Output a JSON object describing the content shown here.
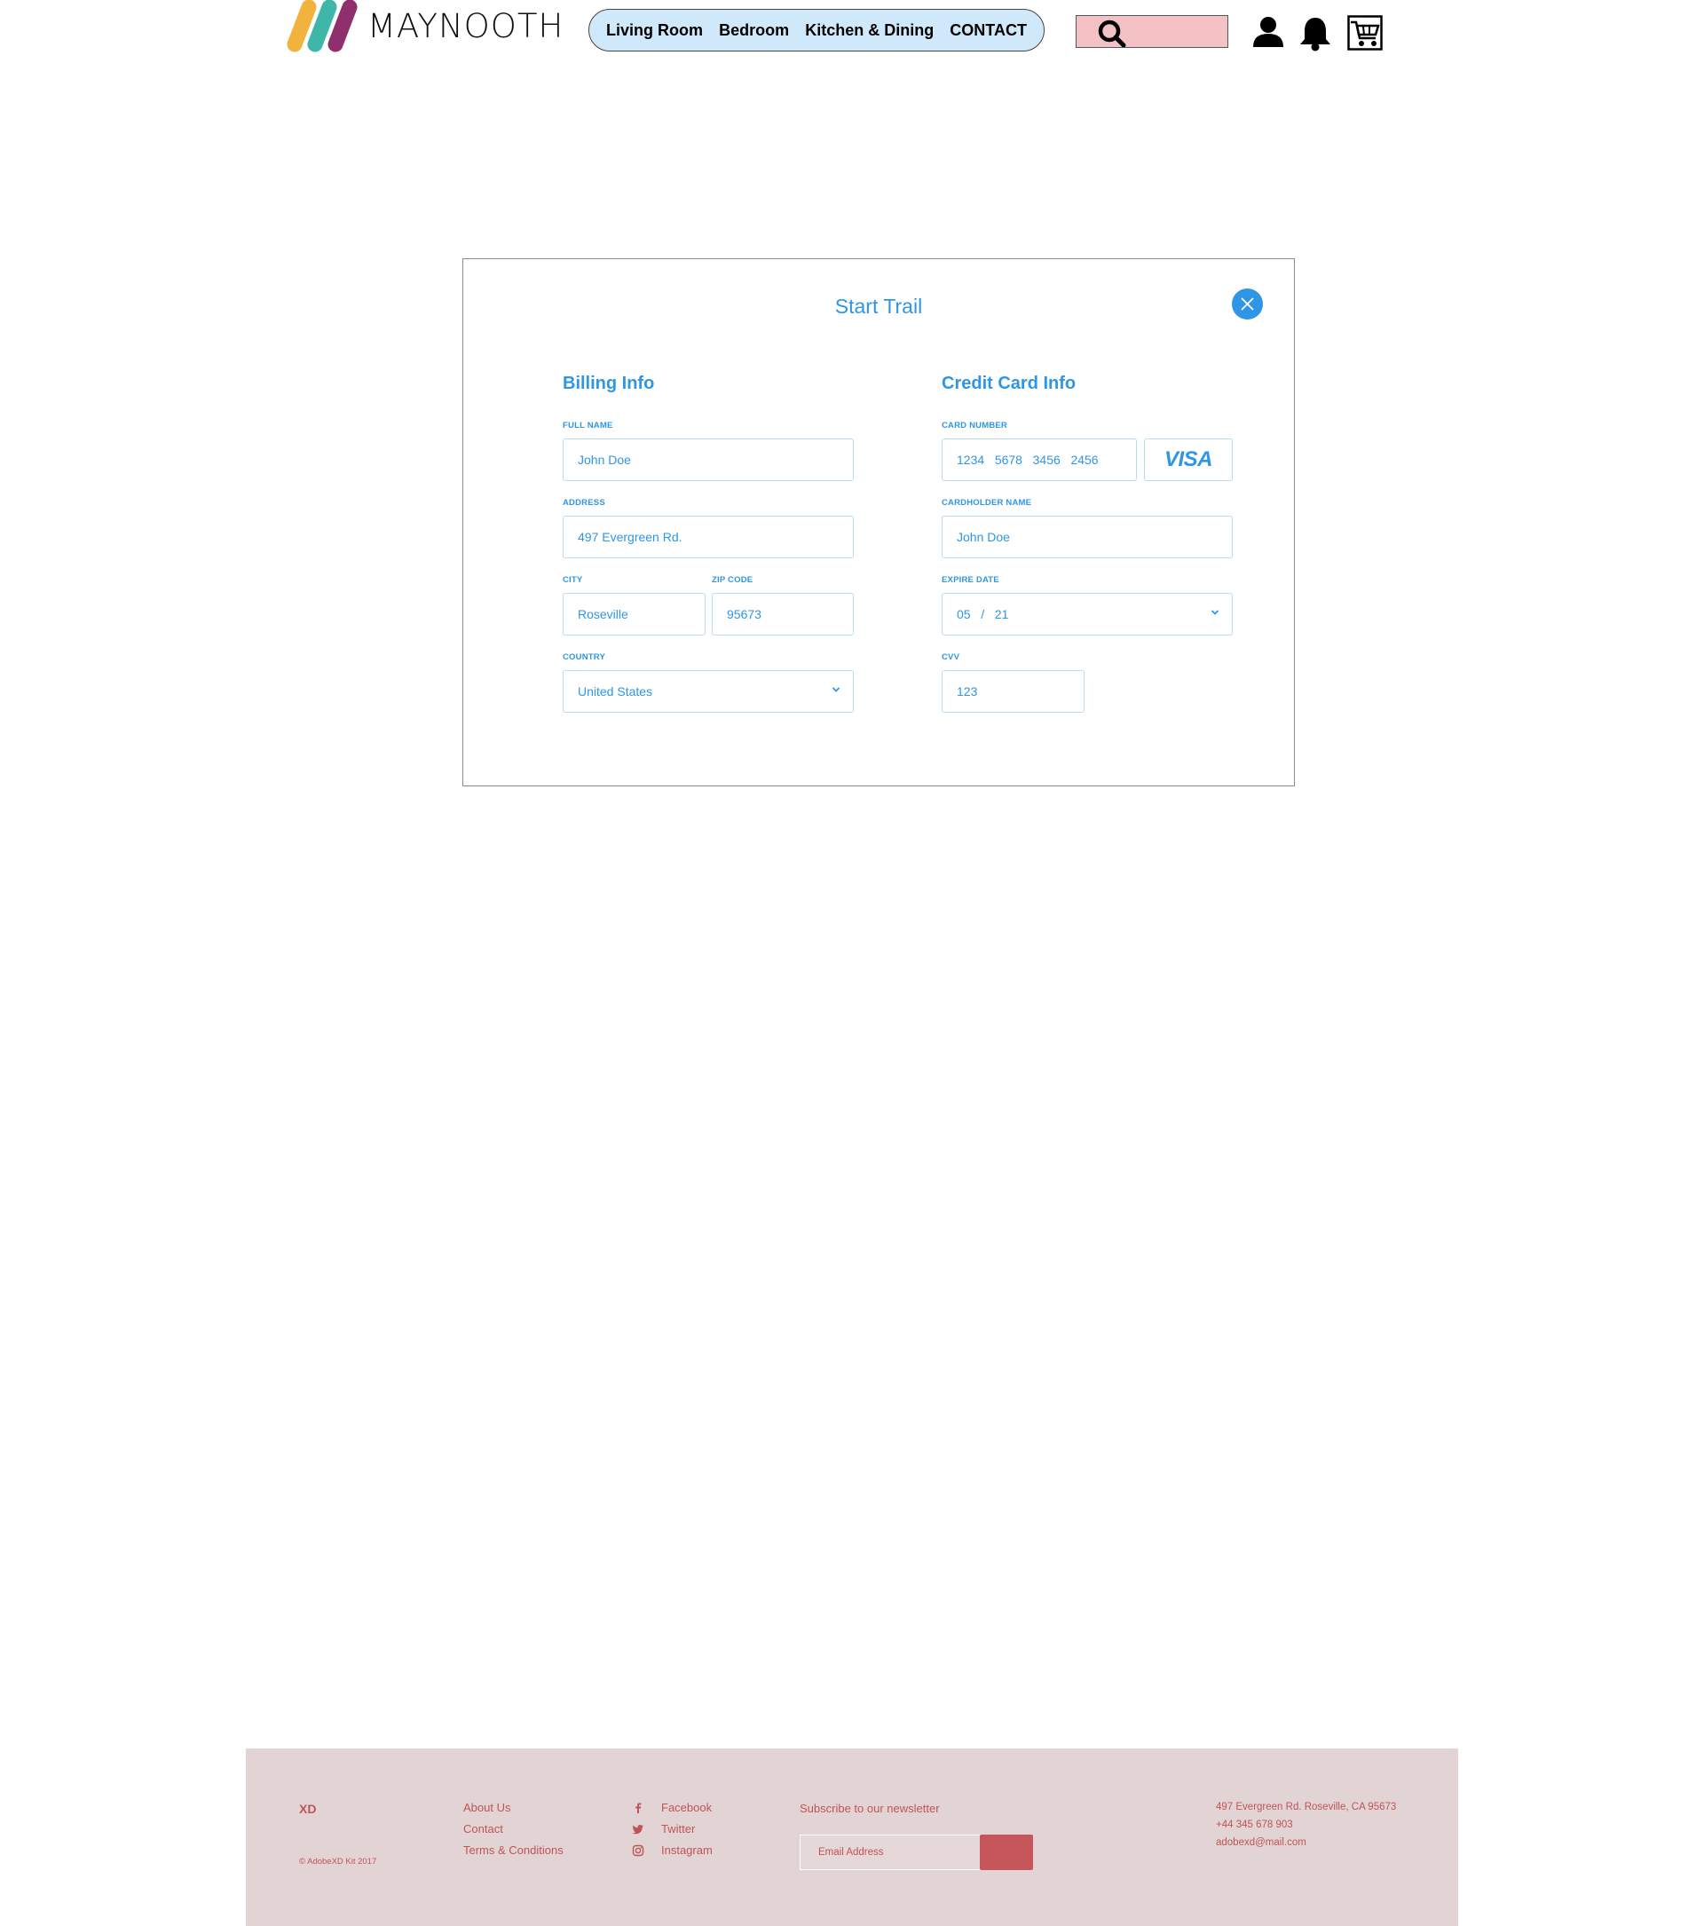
{
  "header": {
    "logo_text": "MAYNOOTH",
    "nav": [
      "Living Room",
      "Bedroom",
      "Kitchen & Dining",
      "CONTACT"
    ],
    "search_value": "",
    "icons": [
      "search-icon",
      "user-icon",
      "bell-icon",
      "cart-icon"
    ]
  },
  "modal": {
    "title": "Start Trail",
    "billing": {
      "heading": "Billing Info",
      "full_name_label": "FULL NAME",
      "full_name": "John Doe",
      "address_label": "ADDRESS",
      "address": "497 Evergreen Rd.",
      "city_label": "CITY",
      "city": "Roseville",
      "zip_label": "ZIP CODE",
      "zip": "95673",
      "country_label": "COUNTRY",
      "country": "United States"
    },
    "card": {
      "heading": "Credit Card Info",
      "number_label": "CARD NUMBER",
      "number": "1234   5678   3456   2456",
      "brand": "VISA",
      "holder_label": "CARDHOLDER NAME",
      "holder": "John Doe",
      "expire_label": "EXPIRE DATE",
      "expire": "05   /   21",
      "cvv_label": "CVV",
      "cvv": "123"
    }
  },
  "footer": {
    "brand": "XD",
    "copyright": "© AdobeXD Kit 2017",
    "links": [
      "About Us",
      "Contact",
      "Terms & Conditions"
    ],
    "social": [
      "Facebook",
      "Twitter",
      "Instagram"
    ],
    "newsletter_label": "Subscribe to our newsletter",
    "email_placeholder": "Email Address",
    "address": "497 Evergreen Rd. Roseville, CA 95673",
    "phone": "+44 345 678 903",
    "email": "adobexd@mail.com"
  },
  "colors": {
    "accent": "#2f96e6",
    "nav_bg": "#cfe9fb",
    "search_bg": "#f4c2c4",
    "footer_bg": "#e2d4d5",
    "footer_text": "#c05357"
  }
}
